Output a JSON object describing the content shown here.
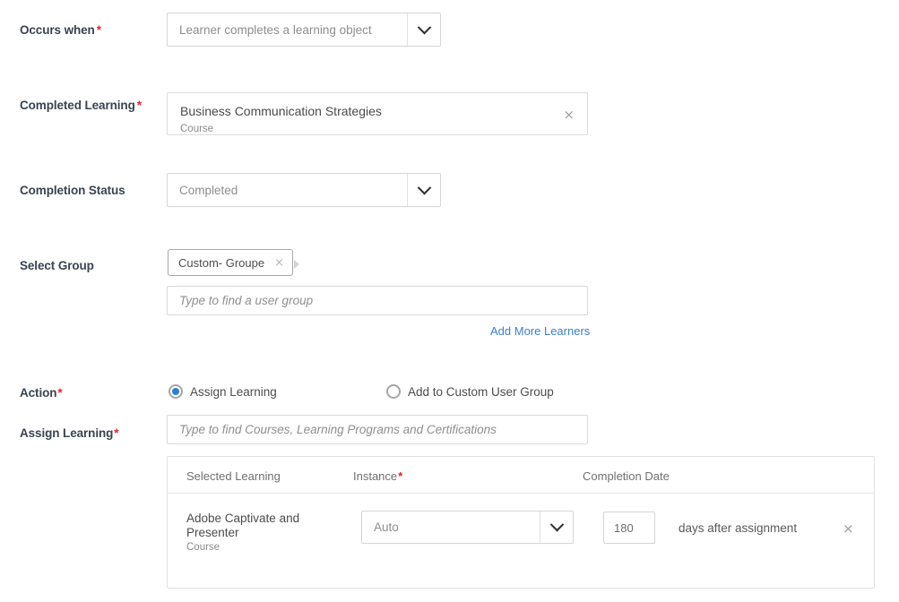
{
  "form": {
    "occurs_when": {
      "label": "Occurs when",
      "required": "*",
      "value": "Learner completes a learning object"
    },
    "completed_learning": {
      "label": "Completed Learning",
      "required": "*",
      "title": "Business Communication Strategies",
      "subtitle": "Course",
      "remove_icon": "×"
    },
    "completion_status": {
      "label": "Completion Status",
      "value": "Completed"
    },
    "select_group": {
      "label": "Select Group",
      "chip": "Custom- Groupe",
      "chip_remove_icon": "×",
      "placeholder": "Type to find a user group",
      "add_more_link": "Add More Learners"
    },
    "action": {
      "label": "Action",
      "required": "*",
      "options": [
        {
          "label": "Assign Learning",
          "selected": true
        },
        {
          "label": "Add to Custom User Group",
          "selected": false
        }
      ]
    },
    "assign_learning": {
      "label": "Assign Learning",
      "required": "*",
      "placeholder": "Type to find Courses, Learning Programs and Certifications"
    },
    "learning_table": {
      "columns": [
        {
          "label": "Selected Learning",
          "required": ""
        },
        {
          "label": "Instance",
          "required": "*"
        },
        {
          "label": "Completion Date",
          "required": ""
        }
      ],
      "rows": [
        {
          "title": "Adobe Captivate and Presenter",
          "subtitle": "Course",
          "instance": "Auto",
          "days": "180",
          "days_suffix": "days after assignment",
          "remove_icon": "×"
        }
      ]
    }
  },
  "colors": {
    "accent_link": "#3c7fd0",
    "radio_selected": "#2e7fd4",
    "required_asterisk": "#e8232a",
    "label_text": "#3a4450"
  }
}
